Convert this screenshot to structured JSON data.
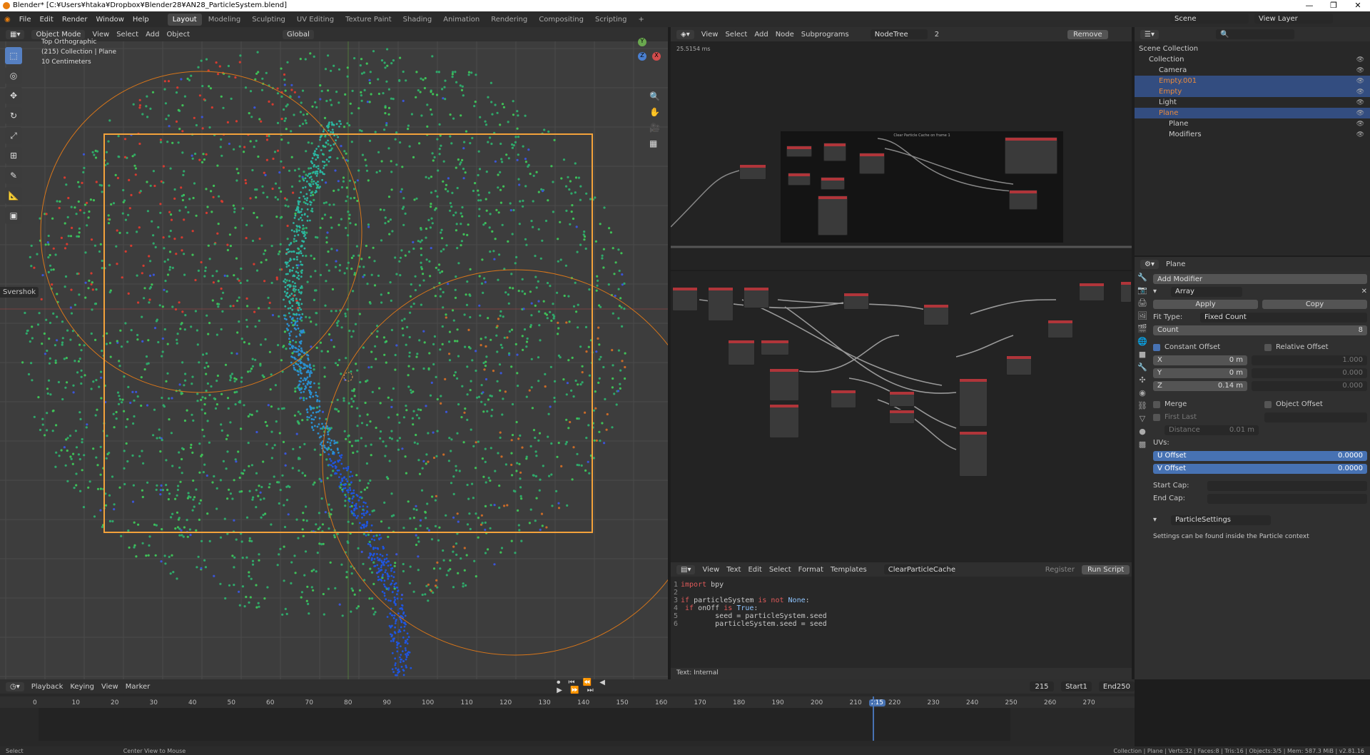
{
  "window": {
    "title": "Blender* [C:¥Users¥htaka¥Dropbox¥Blender28¥AN28_ParticleSystem.blend]",
    "controls": [
      "—",
      "❐",
      "✕"
    ]
  },
  "menus": [
    "File",
    "Edit",
    "Render",
    "Window",
    "Help"
  ],
  "workspaces": [
    "Layout",
    "Modeling",
    "Sculpting",
    "UV Editing",
    "Texture Paint",
    "Shading",
    "Animation",
    "Rendering",
    "Compositing",
    "Scripting",
    "+"
  ],
  "scene": {
    "name": "Scene",
    "view_layer": "View Layer"
  },
  "viewport": {
    "mode": "Object Mode",
    "menus": [
      "View",
      "Select",
      "Add",
      "Object"
    ],
    "orientation": "Global",
    "overlay_lines": [
      "Top Orthographic",
      "(215) Collection | Plane",
      "10 Centimeters"
    ],
    "sidebar_tab": "Svershok",
    "axes": [
      "Y",
      "Z",
      "X"
    ]
  },
  "node_editor": {
    "menus": [
      "View",
      "Select",
      "Add",
      "Node",
      "Subprograms"
    ],
    "tree": "NodeTree",
    "users": "2",
    "remove": "Remove",
    "timing": "25.5154 ms",
    "frame_label": "Clear Particle Cache on frame 1"
  },
  "text_editor": {
    "menus": [
      "View",
      "Text",
      "Edit",
      "Select",
      "Format",
      "Templates"
    ],
    "file": "ClearParticleCache",
    "register": "Register",
    "run": "Run Script",
    "status": "Text: Internal",
    "lines": [
      {
        "n": "1",
        "t": "import bpy"
      },
      {
        "n": "2",
        "t": ""
      },
      {
        "n": "3",
        "t": "if particleSystem is not None:"
      },
      {
        "n": "4",
        "t": "    if onOff is True:"
      },
      {
        "n": "5",
        "t": "        seed = particleSystem.seed"
      },
      {
        "n": "6",
        "t": "        particleSystem.seed = seed"
      }
    ]
  },
  "outliner": {
    "items": [
      {
        "label": "Scene Collection",
        "indent": 0,
        "sel": false
      },
      {
        "label": "Collection",
        "indent": 1,
        "sel": false
      },
      {
        "label": "Camera",
        "indent": 2,
        "sel": false
      },
      {
        "label": "Empty.001",
        "indent": 2,
        "sel": true
      },
      {
        "label": "Empty",
        "indent": 2,
        "sel": true
      },
      {
        "label": "Light",
        "indent": 2,
        "sel": false
      },
      {
        "label": "Plane",
        "indent": 2,
        "sel": true
      },
      {
        "label": "Plane",
        "indent": 3,
        "sel": false
      },
      {
        "label": "Modifiers",
        "indent": 3,
        "sel": false
      }
    ]
  },
  "properties": {
    "object": "Plane",
    "add_modifier": "Add Modifier",
    "modifier_name": "Array",
    "apply": "Apply",
    "copy": "Copy",
    "fit_type_label": "Fit Type:",
    "fit_type": "Fixed Count",
    "count_label": "Count",
    "count": "8",
    "constant_offset": "Constant Offset",
    "relative_offset": "Relative Offset",
    "offsets": [
      {
        "axis": "X",
        "val": "0 m",
        "rel": "1.000"
      },
      {
        "axis": "Y",
        "val": "0 m",
        "rel": "0.000"
      },
      {
        "axis": "Z",
        "val": "0.14 m",
        "rel": "0.000"
      }
    ],
    "merge": "Merge",
    "object_offset": "Object Offset",
    "first_last": "First Last",
    "distance_label": "Distance",
    "distance": "0.01 m",
    "uvs": "UVs:",
    "u_offset": "U Offset",
    "u_val": "0.0000",
    "v_offset": "V Offset",
    "v_val": "0.0000",
    "start_cap": "Start Cap:",
    "end_cap": "End Cap:",
    "particle_mod": "ParticleSettings",
    "particle_note": "Settings can be found inside the Particle context"
  },
  "timeline": {
    "menus": [
      "Playback",
      "Keying",
      "View",
      "Marker"
    ],
    "current": "215",
    "start_label": "Start",
    "start": "1",
    "end_label": "End",
    "end": "250",
    "ticks": [
      "0",
      "10",
      "20",
      "30",
      "40",
      "50",
      "60",
      "70",
      "80",
      "90",
      "100",
      "110",
      "120",
      "130",
      "140",
      "150",
      "160",
      "170",
      "180",
      "190",
      "200",
      "210",
      "215",
      "220",
      "230",
      "240",
      "250",
      "260",
      "270"
    ]
  },
  "statusbar": {
    "left": "Select",
    "mid": "Center View to Mouse",
    "right": "Collection | Plane | Verts:32 | Faces:8 | Tris:16 | Objects:3/5 | Mem: 587.3 MiB | v2.81.16"
  }
}
